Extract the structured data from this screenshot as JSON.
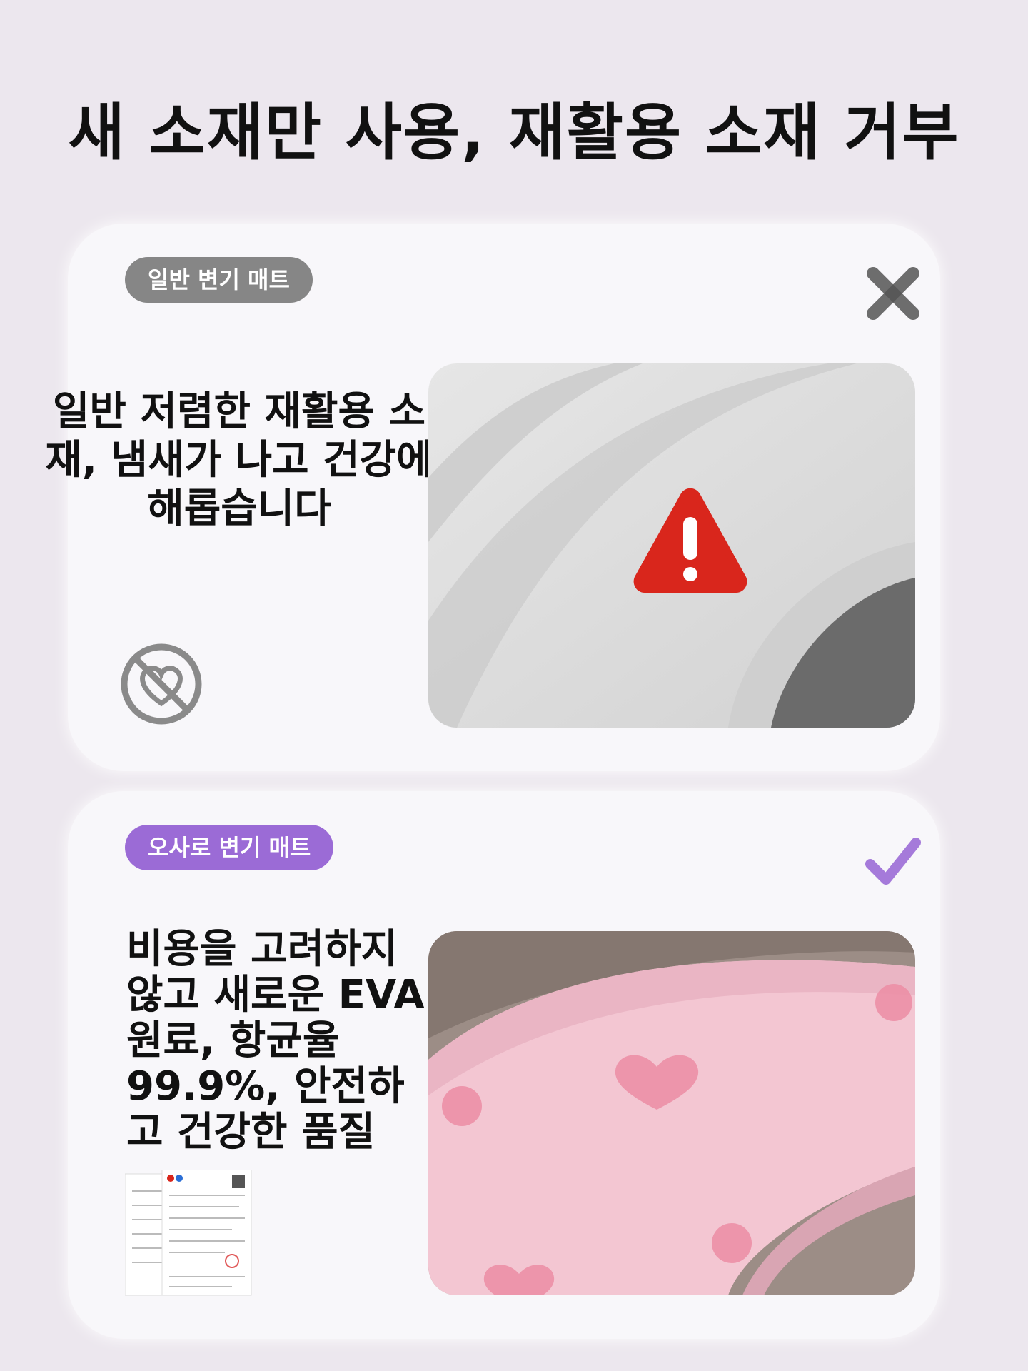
{
  "header": {
    "title": "새 소재만 사용, 재활용 소재 거부"
  },
  "cards": [
    {
      "tag": "일반 변기 매트",
      "mark_icon": "cross-icon",
      "description": "일반 저렴한 재활용 소재, 냄새가 나고 건강에 해롭습니다",
      "badge_icon": "no-heart-icon",
      "photo_overlay_icon": "warning-icon",
      "accent": "#868686"
    },
    {
      "tag": "오사로 변기 매트",
      "mark_icon": "check-icon",
      "description": "비용을 고려하지 않고 새로운 EVA 원료, 항균율 99.9%, 안전하고 건강한 품질",
      "badge_icon": "certificate-documents",
      "accent": "#9b6bd6"
    }
  ]
}
